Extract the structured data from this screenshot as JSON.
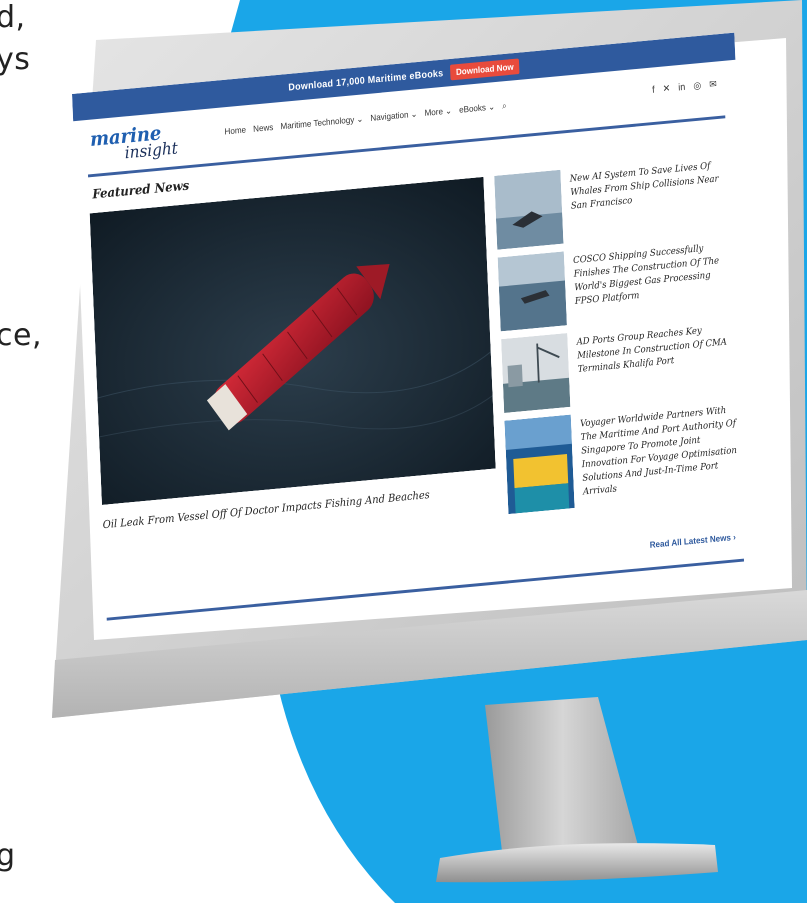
{
  "edge_text": [
    "d,",
    "ys",
    "ce,",
    "g"
  ],
  "topbar": {
    "text": "Download 17,000 Maritime eBooks",
    "button": "Download Now"
  },
  "logo": {
    "line1": "marine",
    "line2": "insight"
  },
  "nav": {
    "items": [
      "Home",
      "News",
      "Maritime Technology ⌄",
      "Navigation ⌄",
      "More ⌄",
      "eBooks ⌄",
      "⌕"
    ]
  },
  "social": [
    "f",
    "✕",
    "in",
    "◎",
    "✉"
  ],
  "featured": {
    "title": "Featured News",
    "main_caption": "Oil Leak From Vessel Off Of Doctor Impacts Fishing And Beaches",
    "side_items": [
      "New AI System To Save Lives Of Whales From Ship Collisions Near San Francisco",
      "COSCO Shipping Successfully Finishes The Construction Of The World's Biggest Gas Processing FPSO Platform",
      "AD Ports Group Reaches Key Milestone In Construction Of CMA Terminals Khalifa Port",
      "Voyager Worldwide Partners With The Maritime And Port Authority Of Singapore To Promote Joint Innovation For Voyage Optimisation Solutions And Just-In-Time Port Arrivals"
    ],
    "read_more": "Read All Latest News ›"
  },
  "colors": {
    "accent_blue": "#2f5a9e",
    "background_blob": "#1aa6e8",
    "cta_red": "#e84b3c",
    "ship_red": "#b71c2a"
  }
}
